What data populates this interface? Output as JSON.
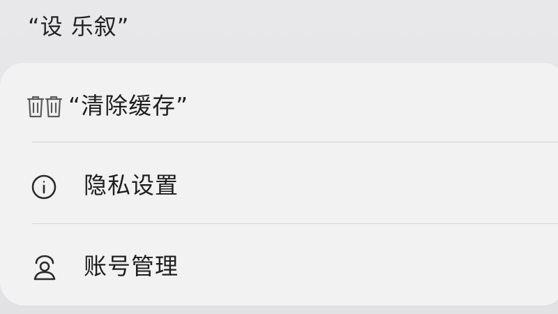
{
  "header": {
    "title": "“设 乐叙”"
  },
  "menu": {
    "items": [
      {
        "label": "“清除缓存”",
        "icon": "trash-icon"
      },
      {
        "label": "隐私设置",
        "icon": "info-circle-icon"
      },
      {
        "label": "账号管理",
        "icon": "user-icon"
      }
    ]
  },
  "colors": {
    "background": "#e6e6e8",
    "card": "#f2f2f3",
    "divider": "#d6d6d8",
    "text": "#1f1f1f",
    "icon": "#555555"
  }
}
